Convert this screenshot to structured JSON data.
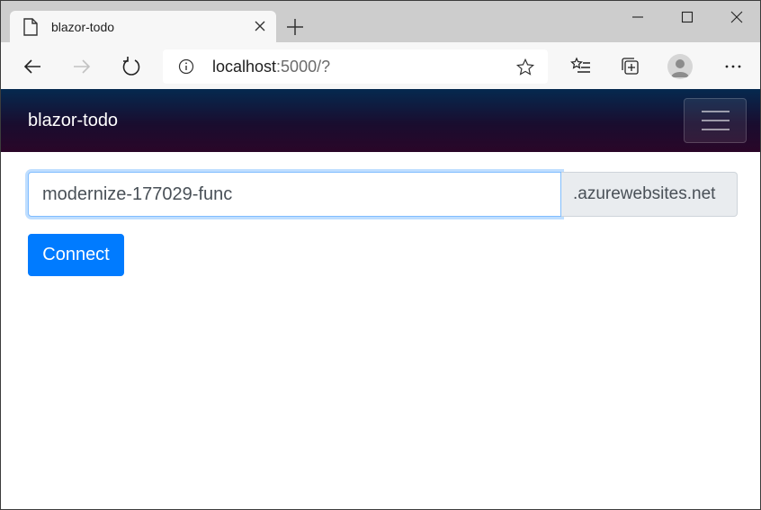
{
  "browser": {
    "tab": {
      "title": "blazor-todo"
    },
    "address_bar": {
      "host": "localhost",
      "rest": ":5000/?"
    }
  },
  "app": {
    "brand": "blazor-todo",
    "form": {
      "site_name_value": "modernize-177029-func",
      "domain_suffix": ".azurewebsites.net",
      "connect_label": "Connect"
    }
  },
  "colors": {
    "primary": "#007bff",
    "navbar_gradient_top": "#05294f",
    "navbar_gradient_bottom": "#2a0628"
  }
}
